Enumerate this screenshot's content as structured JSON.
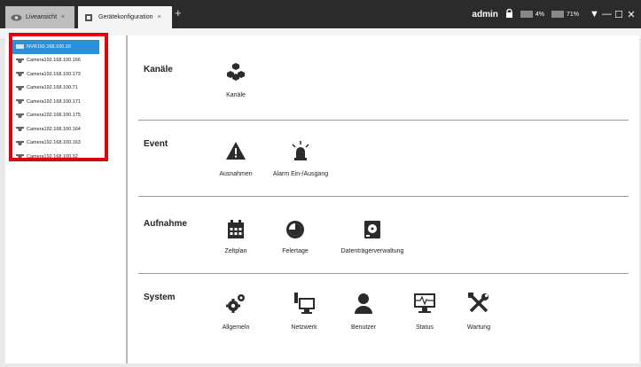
{
  "tabs": [
    {
      "label": "Liveansicht",
      "close": "×"
    },
    {
      "label": "Gerätekonfiguration",
      "close": "×"
    }
  ],
  "tab_add": "+",
  "titlebar": {
    "user": "admin",
    "cpu": "4%",
    "mem": "71%",
    "controls": [
      "▼",
      "—",
      "☐",
      "✕"
    ]
  },
  "tree": [
    "NVR192.168.100.10",
    "Camera192.168.100.166",
    "Camera192.168.100.173",
    "Camera192.168.100.71",
    "Camera192.168.100.171",
    "Camera192.168.100.175",
    "Camera192.168.100.164",
    "Camera192.168.100.163",
    "Camera192.168.100.32"
  ],
  "sections": [
    {
      "title": "Kanäle",
      "items": [
        "Kanäle"
      ]
    },
    {
      "title": "Event",
      "items": [
        "Ausnahmen",
        "Alarm Ein-/Ausgang"
      ]
    },
    {
      "title": "Aufnahme",
      "items": [
        "Zeltplan",
        "Felertage",
        "Datenträgerverwaltung"
      ]
    },
    {
      "title": "System",
      "items": [
        "Allgemeln",
        "Netzwerk",
        "Benutzer",
        "Status",
        "Wartung"
      ]
    }
  ],
  "colors": {
    "highlight": "#e3000f",
    "selected": "#2b8fd9",
    "titlebar": "#2b2b2b"
  }
}
